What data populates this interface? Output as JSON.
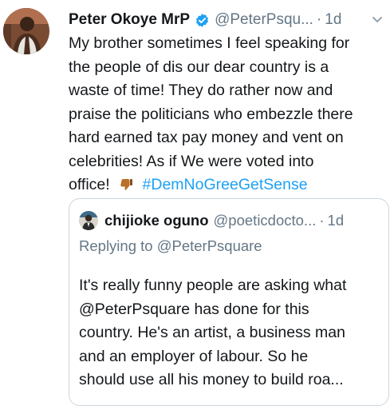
{
  "tweet": {
    "author_name": "Peter Okoye MrP",
    "handle": "@PeterPsqu...",
    "separator": "·",
    "time": "1d",
    "lines": [
      "My brother sometimes I feel speaking for",
      "the people of dis our dear country is a",
      "waste of time! They do rather now and",
      "praise the politicians who embezzle there",
      "hard earned tax pay money and vent on",
      "celebrities! As if We were voted into"
    ],
    "last_line_text": "office!",
    "emoji": "thumbs-down-emoji",
    "hashtag": "#DemNoGreeGetSense"
  },
  "quote": {
    "author_name": "chijioke oguno",
    "handle": "@poeticdocto...",
    "separator": "·",
    "time": "1d",
    "replying_to": "Replying to @PeterPsquare",
    "lines": [
      "It's really funny people are asking what",
      "@PeterPsquare has done for this",
      "country. He's an artist, a business man",
      "and an employer of labour. So he",
      "should use all his money to build roa..."
    ]
  },
  "colors": {
    "text": "#14171a",
    "muted": "#657786",
    "link": "#1da1f2",
    "border": "#ccd6dd"
  }
}
